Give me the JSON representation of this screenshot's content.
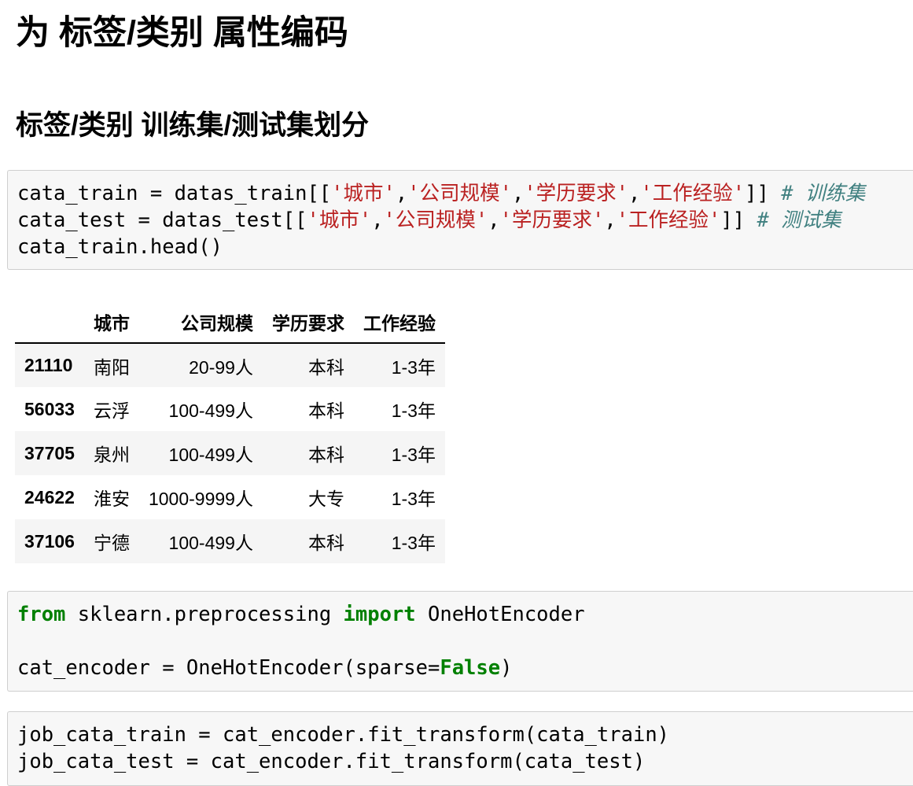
{
  "headings": {
    "title": "为 标签/类别 属性编码",
    "subtitle": "标签/类别 训练集/测试集划分"
  },
  "cell1": {
    "line1": {
      "p1": "cata_train = datas_train[[",
      "s1": "'城市'",
      "p2": ",",
      "s2": "'公司规模'",
      "p3": ",",
      "s3": "'学历要求'",
      "p4": ",",
      "s4": "'工作经验'",
      "p5": "]] ",
      "comment": "# 训练集"
    },
    "line2": {
      "p1": "cata_test = datas_test[[",
      "s1": "'城市'",
      "p2": ",",
      "s2": "'公司规模'",
      "p3": ",",
      "s3": "'学历要求'",
      "p4": ",",
      "s4": "'工作经验'",
      "p5": "]] ",
      "comment": "# 测试集"
    },
    "line3": "cata_train.head()"
  },
  "table": {
    "columns": [
      "",
      "城市",
      "公司规模",
      "学历要求",
      "工作经验"
    ],
    "rows": [
      {
        "index": "21110",
        "cells": [
          "南阳",
          "20-99人",
          "本科",
          "1-3年"
        ]
      },
      {
        "index": "56033",
        "cells": [
          "云浮",
          "100-499人",
          "本科",
          "1-3年"
        ]
      },
      {
        "index": "37705",
        "cells": [
          "泉州",
          "100-499人",
          "本科",
          "1-3年"
        ]
      },
      {
        "index": "24622",
        "cells": [
          "淮安",
          "1000-9999人",
          "大专",
          "1-3年"
        ]
      },
      {
        "index": "37106",
        "cells": [
          "宁德",
          "100-499人",
          "本科",
          "1-3年"
        ]
      }
    ]
  },
  "cell2": {
    "line1": {
      "kw_from": "from",
      "module": " sklearn.preprocessing ",
      "kw_import": "import",
      "name": " OneHotEncoder"
    },
    "line3": {
      "p1": "cat_encoder = OneHotEncoder(sparse=",
      "kw": "False",
      "p2": ")"
    }
  },
  "cell3": {
    "line1": "job_cata_train = cat_encoder.fit_transform(cata_train)",
    "line2": "job_cata_test = cat_encoder.fit_transform(cata_test)"
  },
  "colors": {
    "string": "#ba2121",
    "comment": "#408080",
    "keyword": "#008000",
    "cell_background": "#f7f7f7",
    "cell_border": "#cfcfcf"
  }
}
